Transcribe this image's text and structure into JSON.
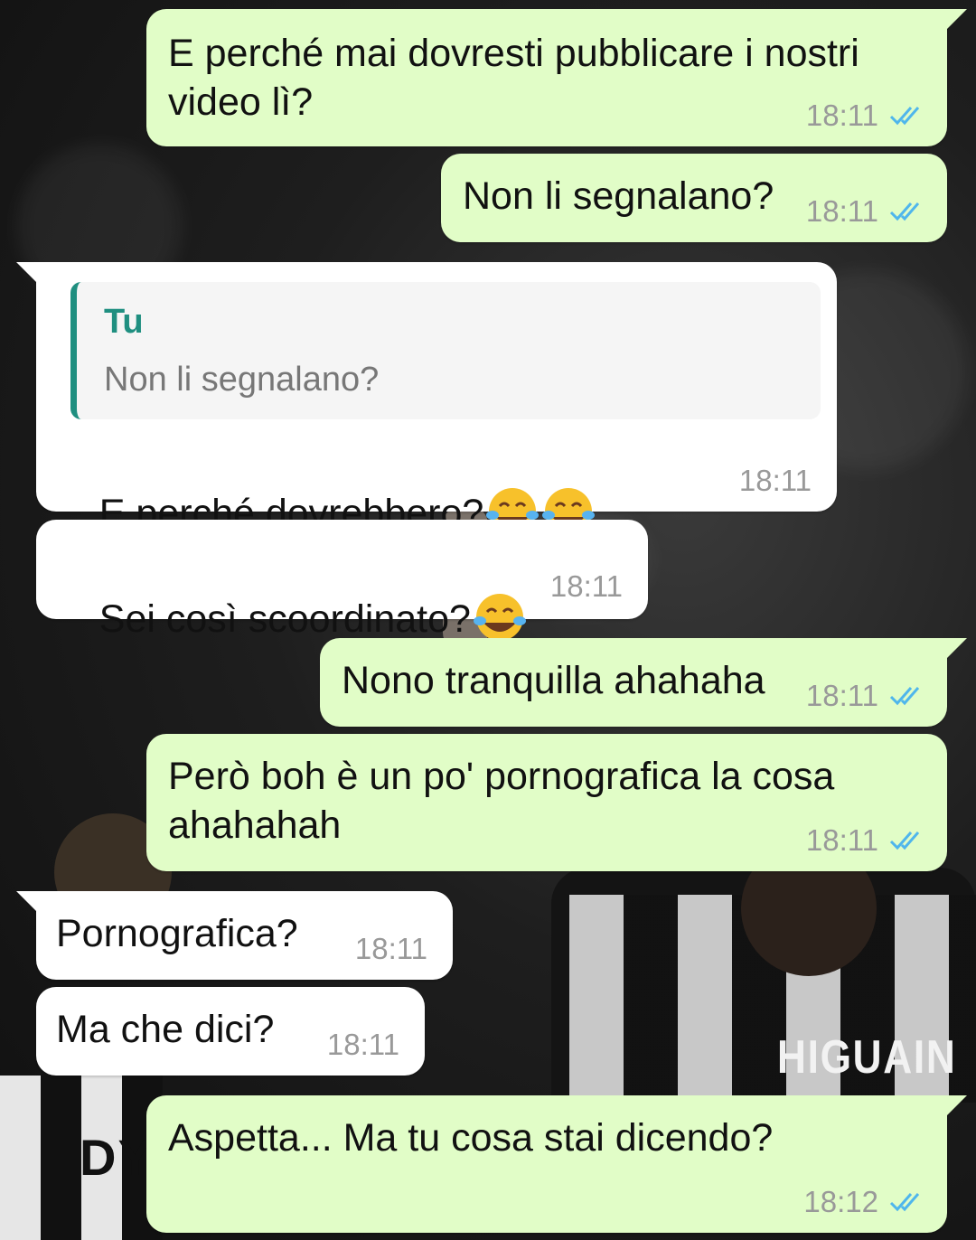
{
  "colors": {
    "outgoing_bubble": "#e1fdc7",
    "incoming_bubble": "#ffffff",
    "read_ticks": "#4fb6ec",
    "quote_accent": "#1f8f80",
    "timestamp": "#999999"
  },
  "background": {
    "jersey_names": [
      "HIGUAIN",
      "DY"
    ]
  },
  "messages": [
    {
      "direction": "out",
      "text": "E perché mai dovresti pubblicare i nostri\nvideo lì?",
      "time": "18:11",
      "status": "read"
    },
    {
      "direction": "out",
      "text": "Non li segnalano?",
      "time": "18:11",
      "status": "read"
    },
    {
      "direction": "in",
      "quote": {
        "author": "Tu",
        "text": "Non li segnalano?"
      },
      "text": "E perché dovrebbero?",
      "emoji": [
        "face-with-tears-of-joy",
        "face-with-tears-of-joy"
      ],
      "time": "18:11"
    },
    {
      "direction": "in",
      "text": "Sei così scoordinato?",
      "emoji": [
        "face-with-tears-of-joy"
      ],
      "time": "18:11"
    },
    {
      "direction": "out",
      "text": "Nono tranquilla ahahaha",
      "time": "18:11",
      "status": "read"
    },
    {
      "direction": "out",
      "text": "Però boh è un po' pornografica la cosa\nahahahah",
      "time": "18:11",
      "status": "read"
    },
    {
      "direction": "in",
      "text": "Pornografica?",
      "time": "18:11"
    },
    {
      "direction": "in",
      "text": "Ma che dici?",
      "time": "18:11"
    },
    {
      "direction": "out",
      "text": "Aspetta... Ma tu cosa stai dicendo?",
      "time": "18:12",
      "status": "read"
    }
  ]
}
